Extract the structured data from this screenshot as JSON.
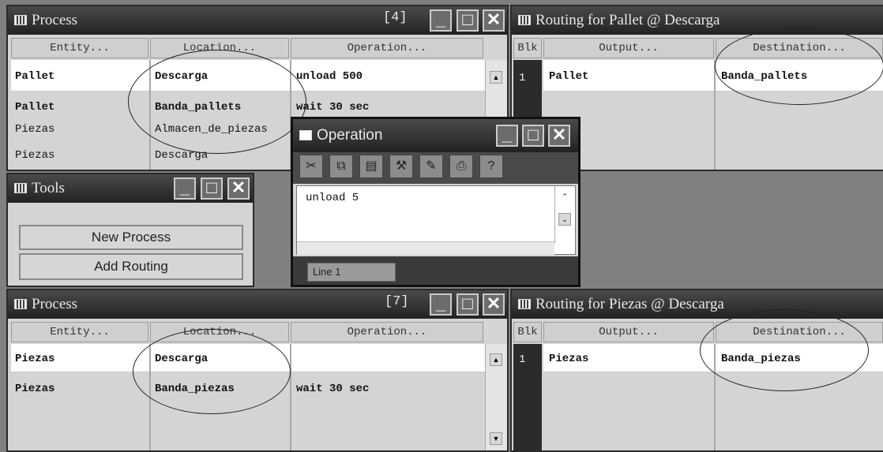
{
  "process_top": {
    "title": "Process",
    "count": "[4]",
    "columns": [
      "Entity...",
      "Location...",
      "Operation..."
    ],
    "rows": [
      {
        "entity": "Pallet",
        "location": "Descarga",
        "operation": "unload 500"
      },
      {
        "entity": "Pallet",
        "location": "Banda_pallets",
        "operation": "wait 30 sec"
      },
      {
        "entity": "Piezas",
        "location": "Almacen_de_piezas",
        "operation": ""
      },
      {
        "entity": "Piezas",
        "location": "Descarga",
        "operation": ""
      }
    ]
  },
  "routing_top": {
    "title": "Routing for Pallet @ Descarga",
    "columns": [
      "Blk",
      "Output...",
      "Destination..."
    ],
    "rows": [
      {
        "blk": "1",
        "output": "Pallet",
        "destination": "Banda_pallets"
      }
    ]
  },
  "operation": {
    "title": "Operation",
    "text": "unload 5",
    "status": "Line 1",
    "tools": [
      "cut-icon",
      "copy-icon",
      "paste-icon",
      "build-icon",
      "notes-icon",
      "print-icon",
      "help-icon"
    ]
  },
  "tools": {
    "title": "Tools",
    "buttons": [
      "New Process",
      "Add Routing"
    ]
  },
  "process_bottom": {
    "title": "Process",
    "count": "[7]",
    "columns": [
      "Entity...",
      "Location...",
      "Operation..."
    ],
    "rows": [
      {
        "entity": "Piezas",
        "location": "Descarga",
        "operation": ""
      },
      {
        "entity": "Piezas",
        "location": "Banda_piezas",
        "operation": "wait 30 sec"
      }
    ]
  },
  "routing_bottom": {
    "title": "Routing for Piezas @ Descarga",
    "columns": [
      "Blk",
      "Output...",
      "Destination..."
    ],
    "rows": [
      {
        "blk": "1",
        "output": "Piezas",
        "destination": "Banda_piezas"
      }
    ]
  }
}
